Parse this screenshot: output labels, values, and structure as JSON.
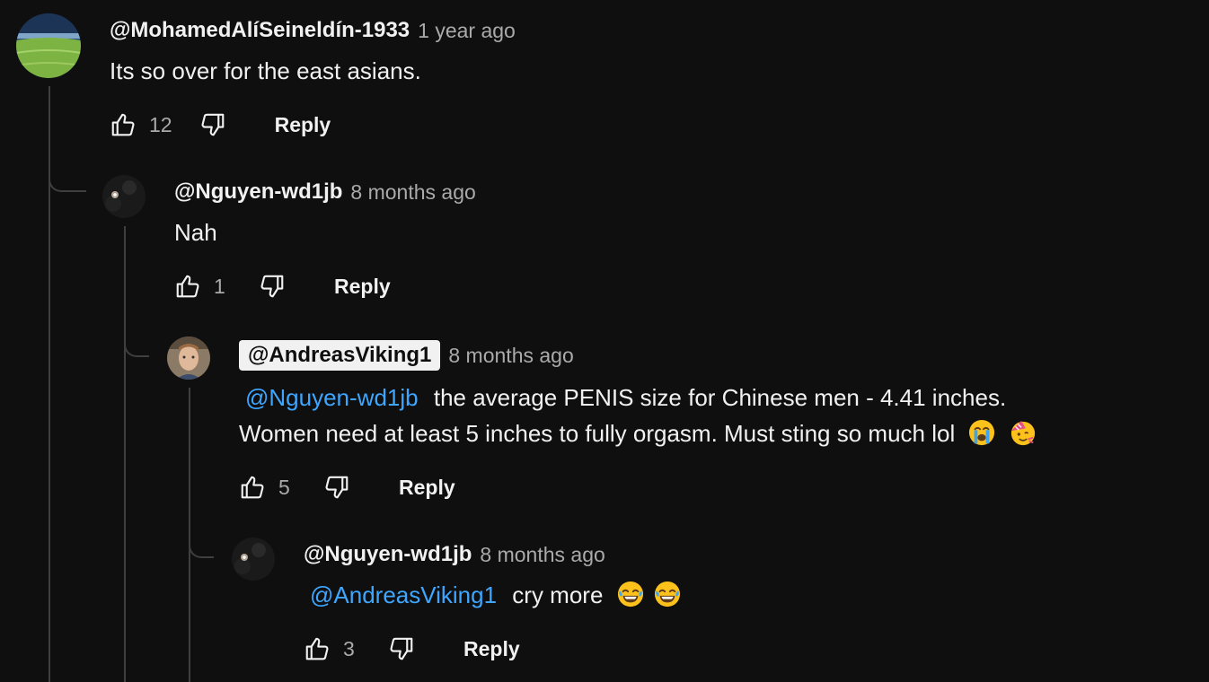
{
  "comments": [
    {
      "handle": "@MohamedAlíSeineldín-1933",
      "time": "1 year ago",
      "text": "Its so over for the east asians.",
      "likes": "12",
      "reply_label": "Reply",
      "avatar": "soccer-stadium-avatar"
    },
    {
      "handle": "@Nguyen-wd1jb",
      "time": "8 months ago",
      "text": "Nah",
      "likes": "1",
      "reply_label": "Reply",
      "avatar": "dark-sparkle-avatar"
    },
    {
      "handle": "@AndreasViking1",
      "time": "8 months ago",
      "mention": "@Nguyen-wd1jb",
      "text_line1": "the average PENIS size for Chinese men - 4.41 inches.",
      "text_line2": "Women need at least 5 inches to fully orgasm. Must sting so much lol",
      "emojis": [
        "loudly-crying-face",
        "partying-face"
      ],
      "likes": "5",
      "reply_label": "Reply",
      "avatar": "man-portrait-avatar"
    },
    {
      "handle": "@Nguyen-wd1jb",
      "time": "8 months ago",
      "mention": "@AndreasViking1",
      "text": "cry more",
      "emojis": [
        "face-with-tears-of-joy",
        "face-with-tears-of-joy"
      ],
      "likes": "3",
      "reply_label": "Reply",
      "avatar": "dark-sparkle-avatar"
    }
  ],
  "colors": {
    "background": "#0f0f0f",
    "text": "#f1f1f1",
    "muted": "#aaaaaa",
    "mention": "#3ea6ff",
    "thread_line": "#3f3f3f"
  }
}
